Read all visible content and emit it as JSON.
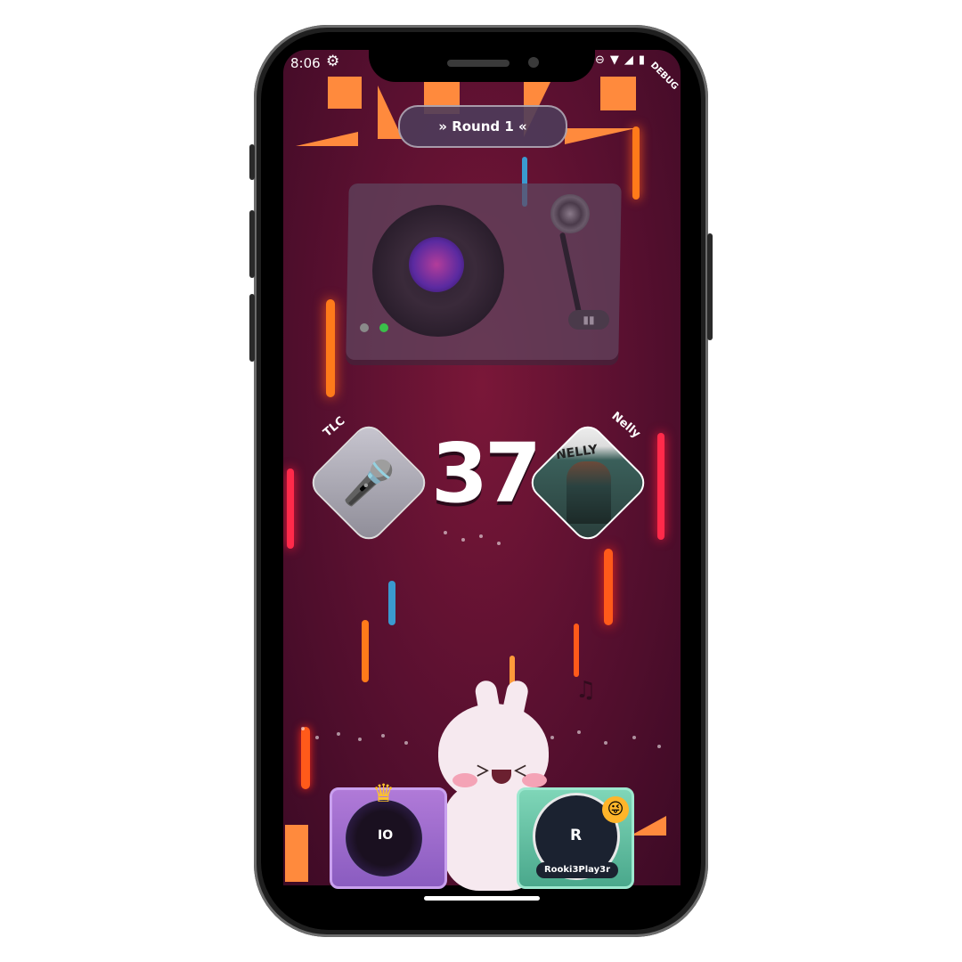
{
  "status_bar": {
    "time": "8:06",
    "debug_label": "DEBUG"
  },
  "round": {
    "label": "» Round 1 «"
  },
  "countdown": {
    "value": "37"
  },
  "artists": {
    "left": {
      "name": "TLC",
      "icon": "microphone-icon"
    },
    "right": {
      "name": "Nelly",
      "album_text": "NELLY"
    }
  },
  "players": {
    "left": {
      "avatar_text": "IO",
      "badge": "crown-icon"
    },
    "right": {
      "avatar_text": "R",
      "name": "Rooki3Play3r",
      "badge": "emoji-icon"
    }
  },
  "colors": {
    "accent_orange": "#ff8a3d",
    "background": "#5a1030",
    "player_left_card": "#a06ed0",
    "player_right_card": "#5fc2a2"
  }
}
